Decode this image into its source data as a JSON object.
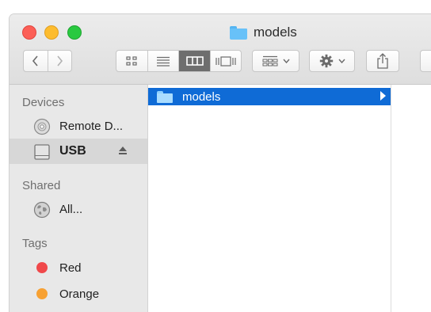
{
  "window": {
    "title": "models"
  },
  "sidebar": {
    "sections": [
      {
        "header": "Devices",
        "items": [
          {
            "label": "Remote D...",
            "icon": "remote-disc-icon"
          },
          {
            "label": "USB",
            "icon": "external-drive-icon",
            "selected": true
          }
        ]
      },
      {
        "header": "Shared",
        "items": [
          {
            "label": "All...",
            "icon": "network-globe-icon"
          }
        ]
      },
      {
        "header": "Tags",
        "items": [
          {
            "label": "Red",
            "color": "#f0484a"
          },
          {
            "label": "Orange",
            "color": "#f7a133"
          }
        ]
      }
    ]
  },
  "column": {
    "items": [
      {
        "label": "models",
        "selected": true
      }
    ]
  },
  "colors": {
    "selection": "#0f6bd6",
    "folder": "#68c1f8"
  }
}
